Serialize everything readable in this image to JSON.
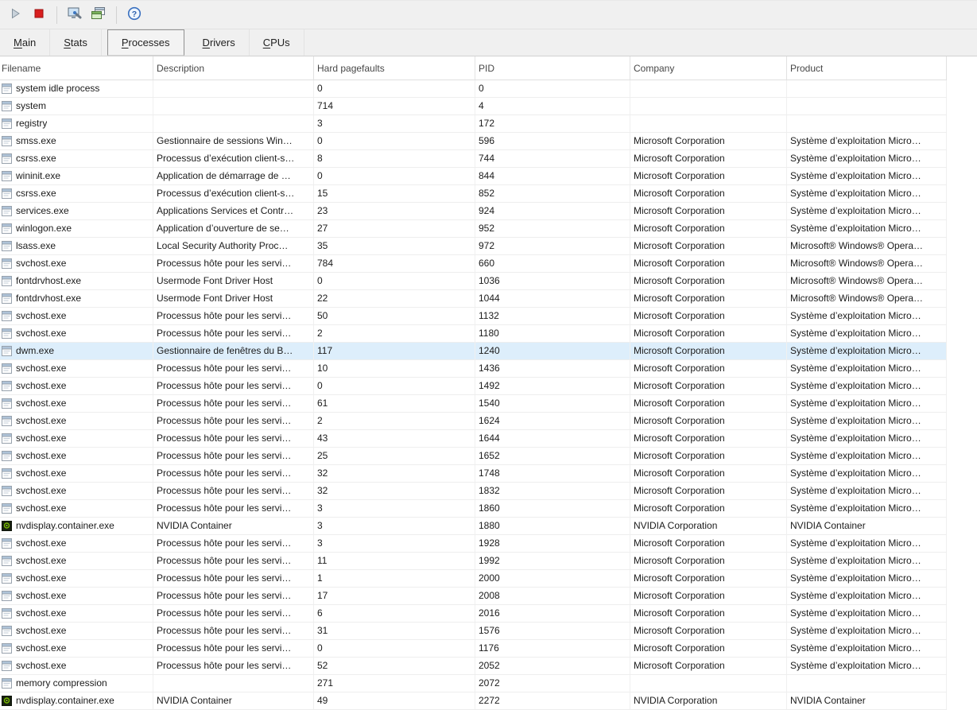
{
  "toolbar": {
    "buttons": [
      {
        "name": "start",
        "icon": "play-icon"
      },
      {
        "name": "stop",
        "icon": "stop-icon"
      },
      {
        "name": "system-tools",
        "icon": "computer-tools-icon"
      },
      {
        "name": "windows-list",
        "icon": "layered-windows-icon"
      },
      {
        "name": "help",
        "icon": "help-icon"
      }
    ]
  },
  "tabs": [
    {
      "label": "Main",
      "accel": "M",
      "selected": false
    },
    {
      "label": "Stats",
      "accel": "S",
      "selected": false
    },
    {
      "label": "Processes",
      "accel": "P",
      "selected": true
    },
    {
      "label": "Drivers",
      "accel": "D",
      "selected": false
    },
    {
      "label": "CPUs",
      "accel": "C",
      "selected": false
    }
  ],
  "table": {
    "columns": [
      {
        "key": "filename",
        "label": "Filename"
      },
      {
        "key": "description",
        "label": "Description"
      },
      {
        "key": "hard_pagefaults",
        "label": "Hard pagefaults"
      },
      {
        "key": "pid",
        "label": "PID"
      },
      {
        "key": "company",
        "label": "Company"
      },
      {
        "key": "product",
        "label": "Product"
      }
    ],
    "selected_pid": "1240",
    "rows": [
      {
        "icon": "default",
        "filename": "system idle process",
        "description": "",
        "hard_pagefaults": "0",
        "pid": "0",
        "company": "",
        "product": ""
      },
      {
        "icon": "default",
        "filename": "system",
        "description": "",
        "hard_pagefaults": "714",
        "pid": "4",
        "company": "",
        "product": ""
      },
      {
        "icon": "default",
        "filename": "registry",
        "description": "",
        "hard_pagefaults": "3",
        "pid": "172",
        "company": "",
        "product": ""
      },
      {
        "icon": "default",
        "filename": "smss.exe",
        "description": "Gestionnaire de sessions Win…",
        "hard_pagefaults": "0",
        "pid": "596",
        "company": "Microsoft Corporation",
        "product": "Système d’exploitation Micro…"
      },
      {
        "icon": "default",
        "filename": "csrss.exe",
        "description": "Processus d’exécution client-s…",
        "hard_pagefaults": "8",
        "pid": "744",
        "company": "Microsoft Corporation",
        "product": "Système d’exploitation Micro…"
      },
      {
        "icon": "default",
        "filename": "wininit.exe",
        "description": "Application de démarrage de …",
        "hard_pagefaults": "0",
        "pid": "844",
        "company": "Microsoft Corporation",
        "product": "Système d’exploitation Micro…"
      },
      {
        "icon": "default",
        "filename": "csrss.exe",
        "description": "Processus d’exécution client-s…",
        "hard_pagefaults": "15",
        "pid": "852",
        "company": "Microsoft Corporation",
        "product": "Système d’exploitation Micro…"
      },
      {
        "icon": "default",
        "filename": "services.exe",
        "description": "Applications Services et Contr…",
        "hard_pagefaults": "23",
        "pid": "924",
        "company": "Microsoft Corporation",
        "product": "Système d’exploitation Micro…"
      },
      {
        "icon": "default",
        "filename": "winlogon.exe",
        "description": "Application d’ouverture de se…",
        "hard_pagefaults": "27",
        "pid": "952",
        "company": "Microsoft Corporation",
        "product": "Système d’exploitation Micro…"
      },
      {
        "icon": "default",
        "filename": "lsass.exe",
        "description": "Local Security Authority Proc…",
        "hard_pagefaults": "35",
        "pid": "972",
        "company": "Microsoft Corporation",
        "product": "Microsoft® Windows® Opera…"
      },
      {
        "icon": "default",
        "filename": "svchost.exe",
        "description": "Processus hôte pour les servi…",
        "hard_pagefaults": "784",
        "pid": "660",
        "company": "Microsoft Corporation",
        "product": "Microsoft® Windows® Opera…"
      },
      {
        "icon": "default",
        "filename": "fontdrvhost.exe",
        "description": "Usermode Font Driver Host",
        "hard_pagefaults": "0",
        "pid": "1036",
        "company": "Microsoft Corporation",
        "product": "Microsoft® Windows® Opera…"
      },
      {
        "icon": "default",
        "filename": "fontdrvhost.exe",
        "description": "Usermode Font Driver Host",
        "hard_pagefaults": "22",
        "pid": "1044",
        "company": "Microsoft Corporation",
        "product": "Microsoft® Windows® Opera…"
      },
      {
        "icon": "default",
        "filename": "svchost.exe",
        "description": "Processus hôte pour les servi…",
        "hard_pagefaults": "50",
        "pid": "1132",
        "company": "Microsoft Corporation",
        "product": "Système d’exploitation Micro…"
      },
      {
        "icon": "default",
        "filename": "svchost.exe",
        "description": "Processus hôte pour les servi…",
        "hard_pagefaults": "2",
        "pid": "1180",
        "company": "Microsoft Corporation",
        "product": "Système d’exploitation Micro…"
      },
      {
        "icon": "default",
        "filename": "dwm.exe",
        "description": "Gestionnaire de fenêtres du B…",
        "hard_pagefaults": "117",
        "pid": "1240",
        "company": "Microsoft Corporation",
        "product": "Système d’exploitation Micro…",
        "selected": true
      },
      {
        "icon": "default",
        "filename": "svchost.exe",
        "description": "Processus hôte pour les servi…",
        "hard_pagefaults": "10",
        "pid": "1436",
        "company": "Microsoft Corporation",
        "product": "Système d’exploitation Micro…"
      },
      {
        "icon": "default",
        "filename": "svchost.exe",
        "description": "Processus hôte pour les servi…",
        "hard_pagefaults": "0",
        "pid": "1492",
        "company": "Microsoft Corporation",
        "product": "Système d’exploitation Micro…"
      },
      {
        "icon": "default",
        "filename": "svchost.exe",
        "description": "Processus hôte pour les servi…",
        "hard_pagefaults": "61",
        "pid": "1540",
        "company": "Microsoft Corporation",
        "product": "Système d’exploitation Micro…"
      },
      {
        "icon": "default",
        "filename": "svchost.exe",
        "description": "Processus hôte pour les servi…",
        "hard_pagefaults": "2",
        "pid": "1624",
        "company": "Microsoft Corporation",
        "product": "Système d’exploitation Micro…"
      },
      {
        "icon": "default",
        "filename": "svchost.exe",
        "description": "Processus hôte pour les servi…",
        "hard_pagefaults": "43",
        "pid": "1644",
        "company": "Microsoft Corporation",
        "product": "Système d’exploitation Micro…"
      },
      {
        "icon": "default",
        "filename": "svchost.exe",
        "description": "Processus hôte pour les servi…",
        "hard_pagefaults": "25",
        "pid": "1652",
        "company": "Microsoft Corporation",
        "product": "Système d’exploitation Micro…"
      },
      {
        "icon": "default",
        "filename": "svchost.exe",
        "description": "Processus hôte pour les servi…",
        "hard_pagefaults": "32",
        "pid": "1748",
        "company": "Microsoft Corporation",
        "product": "Système d’exploitation Micro…"
      },
      {
        "icon": "default",
        "filename": "svchost.exe",
        "description": "Processus hôte pour les servi…",
        "hard_pagefaults": "32",
        "pid": "1832",
        "company": "Microsoft Corporation",
        "product": "Système d’exploitation Micro…"
      },
      {
        "icon": "default",
        "filename": "svchost.exe",
        "description": "Processus hôte pour les servi…",
        "hard_pagefaults": "3",
        "pid": "1860",
        "company": "Microsoft Corporation",
        "product": "Système d’exploitation Micro…"
      },
      {
        "icon": "nvidia",
        "filename": "nvdisplay.container.exe",
        "description": "NVIDIA Container",
        "hard_pagefaults": "3",
        "pid": "1880",
        "company": "NVIDIA Corporation",
        "product": "NVIDIA Container"
      },
      {
        "icon": "default",
        "filename": "svchost.exe",
        "description": "Processus hôte pour les servi…",
        "hard_pagefaults": "3",
        "pid": "1928",
        "company": "Microsoft Corporation",
        "product": "Système d’exploitation Micro…"
      },
      {
        "icon": "default",
        "filename": "svchost.exe",
        "description": "Processus hôte pour les servi…",
        "hard_pagefaults": "11",
        "pid": "1992",
        "company": "Microsoft Corporation",
        "product": "Système d’exploitation Micro…"
      },
      {
        "icon": "default",
        "filename": "svchost.exe",
        "description": "Processus hôte pour les servi…",
        "hard_pagefaults": "1",
        "pid": "2000",
        "company": "Microsoft Corporation",
        "product": "Système d’exploitation Micro…"
      },
      {
        "icon": "default",
        "filename": "svchost.exe",
        "description": "Processus hôte pour les servi…",
        "hard_pagefaults": "17",
        "pid": "2008",
        "company": "Microsoft Corporation",
        "product": "Système d’exploitation Micro…"
      },
      {
        "icon": "default",
        "filename": "svchost.exe",
        "description": "Processus hôte pour les servi…",
        "hard_pagefaults": "6",
        "pid": "2016",
        "company": "Microsoft Corporation",
        "product": "Système d’exploitation Micro…"
      },
      {
        "icon": "default",
        "filename": "svchost.exe",
        "description": "Processus hôte pour les servi…",
        "hard_pagefaults": "31",
        "pid": "1576",
        "company": "Microsoft Corporation",
        "product": "Système d’exploitation Micro…"
      },
      {
        "icon": "default",
        "filename": "svchost.exe",
        "description": "Processus hôte pour les servi…",
        "hard_pagefaults": "0",
        "pid": "1176",
        "company": "Microsoft Corporation",
        "product": "Système d’exploitation Micro…"
      },
      {
        "icon": "default",
        "filename": "svchost.exe",
        "description": "Processus hôte pour les servi…",
        "hard_pagefaults": "52",
        "pid": "2052",
        "company": "Microsoft Corporation",
        "product": "Système d’exploitation Micro…"
      },
      {
        "icon": "default",
        "filename": "memory compression",
        "description": "",
        "hard_pagefaults": "271",
        "pid": "2072",
        "company": "",
        "product": ""
      },
      {
        "icon": "nvidia",
        "filename": "nvdisplay.container.exe",
        "description": "NVIDIA Container",
        "hard_pagefaults": "49",
        "pid": "2272",
        "company": "NVIDIA Corporation",
        "product": "NVIDIA Container"
      }
    ]
  },
  "colors": {
    "toolbar_bg": "#f0f0f0",
    "selection_bg": "#ddeefb",
    "stop_red": "#d81e1e",
    "help_blue": "#3a70bf",
    "nvidia_green": "#76b900",
    "grid_line": "#eeeeee"
  }
}
